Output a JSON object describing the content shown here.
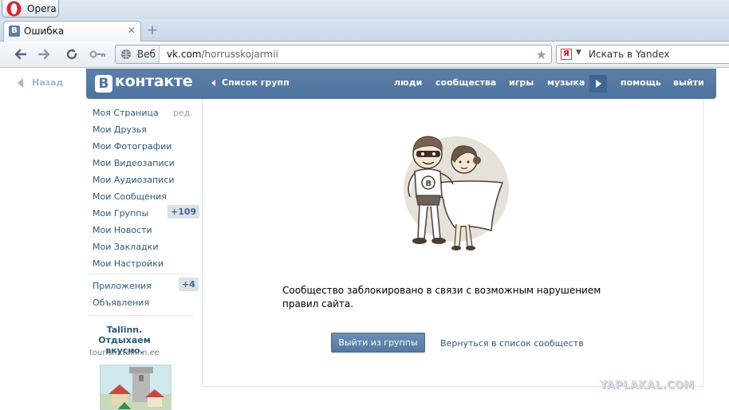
{
  "browser": {
    "menu_label": "Opera",
    "tab": {
      "title": "Ошибка",
      "favicon": "В"
    },
    "address": {
      "badge": "Веб",
      "domain": "vk.com",
      "path": "/horrusskojarmii"
    },
    "search": {
      "engine_icon": "Я",
      "placeholder": "Искать в Yandex"
    }
  },
  "vk": {
    "back_label": "Назад",
    "logo_letter": "В",
    "logo_text": "контакте",
    "groups_link": "Список групп",
    "nav": [
      "люди",
      "сообщества",
      "игры",
      "музыка",
      "помощь",
      "выйти"
    ]
  },
  "sidebar": {
    "items": [
      {
        "label": "Моя Страница",
        "extra": "ред."
      },
      {
        "label": "Мои Друзья"
      },
      {
        "label": "Мои Фотографии"
      },
      {
        "label": "Мои Видеозаписи"
      },
      {
        "label": "Мои Аудиозаписи"
      },
      {
        "label": "Мои Сообщения"
      },
      {
        "label": "Мои Группы",
        "badge": "+109"
      },
      {
        "label": "Мои Новости"
      },
      {
        "label": "Мои Закладки"
      },
      {
        "label": "Мои Настройки"
      }
    ],
    "secondary": [
      {
        "label": "Приложения",
        "badge": "+4"
      },
      {
        "label": "Объявления"
      }
    ],
    "ad": {
      "title": "Tallinn. Отдыхаем вкусно.",
      "domain": "tourism.tallinn.ee"
    }
  },
  "main": {
    "message": "Сообщество заблокировано в связи с возможным нарушением правил сайта.",
    "leave_button": "Выйти из группы",
    "back_link": "Вернуться в список сообществ"
  },
  "watermark": "YAPLAKAL.COM",
  "colors": {
    "vk_blue": "#5b7fa6",
    "link": "#2b587a",
    "badge_bg": "#dae2e8"
  }
}
